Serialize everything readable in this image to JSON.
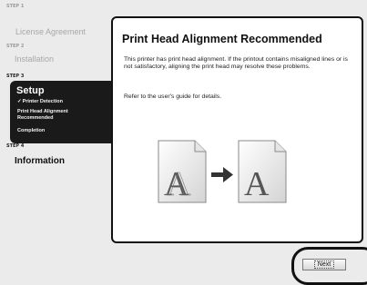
{
  "sidebar": {
    "steps": [
      {
        "label": "STEP 1",
        "title": "License Agreement"
      },
      {
        "label": "STEP 2",
        "title": "Installation"
      },
      {
        "label": "STEP 3",
        "title": "Setup",
        "substeps": [
          "Printer Detection",
          "Print Head Alignment Recommended",
          "Completion"
        ]
      },
      {
        "label": "STEP 4",
        "title": "Information"
      }
    ]
  },
  "panel": {
    "title": "Print Head Alignment Recommended",
    "paragraph1": "This printer has print head alignment. If the printout contains misaligned lines or is not satisfactory, aligning the print head may resolve these problems.",
    "paragraph2": "Refer to the user's guide for details."
  },
  "illustration": {
    "before_letter": "A",
    "after_letter": "A"
  },
  "footer": {
    "next_label": "Next"
  }
}
